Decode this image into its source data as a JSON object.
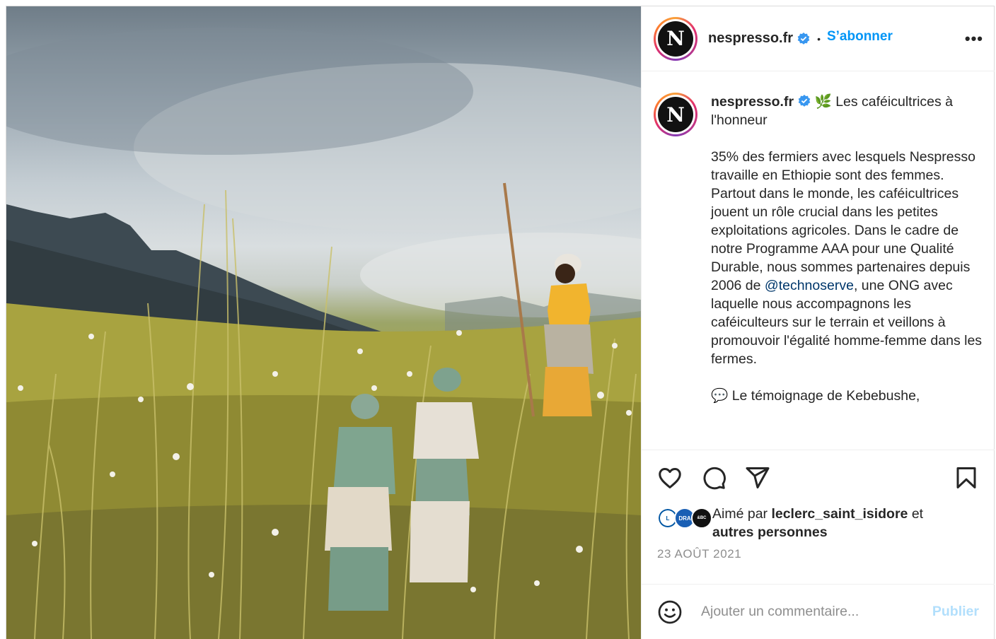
{
  "post": {
    "photo_alt": "",
    "account": {
      "username": "nespresso.fr",
      "avatar_letter": "N",
      "follow_label": "S’abonner",
      "separator": "•",
      "more_label": "•••"
    },
    "caption": {
      "username": "nespresso.fr",
      "title_emoji": "🌿",
      "title": "Les caféicultrices à l'honneur",
      "body_before_mention": "35% des fermiers avec lesquels Nespresso travaille en Ethiopie sont des femmes. Partout dans le monde, les caféicultrices jouent un rôle crucial dans les petites exploitations agricoles. Dans le cadre de notre Programme AAA pour une Qualité Durable, nous sommes partenaires depuis 2006 de ",
      "mention": "@technoserve",
      "body_after_mention": ", une ONG avec laquelle nous accompagnons les caféiculteurs sur le terrain et veillons à promouvoir l'égalité homme-femme dans les fermes.",
      "next_emoji": "💬",
      "next_line": "Le témoignage de Kebebushe,"
    },
    "likes": {
      "prefix": "Aimé par",
      "user": "leclerc_saint_isidore",
      "connector": "et",
      "others": "autres personnes",
      "avatars": [
        "L",
        "DRA",
        "&BC"
      ]
    },
    "date": "23 AOÛT 2021",
    "comment": {
      "placeholder": "Ajouter un commentaire...",
      "publish_label": "Publier"
    },
    "colors": {
      "accent": "#0095f6",
      "verified": "#3897f0",
      "mention": "#00376b",
      "publish_disabled": "#b2dffc"
    }
  }
}
